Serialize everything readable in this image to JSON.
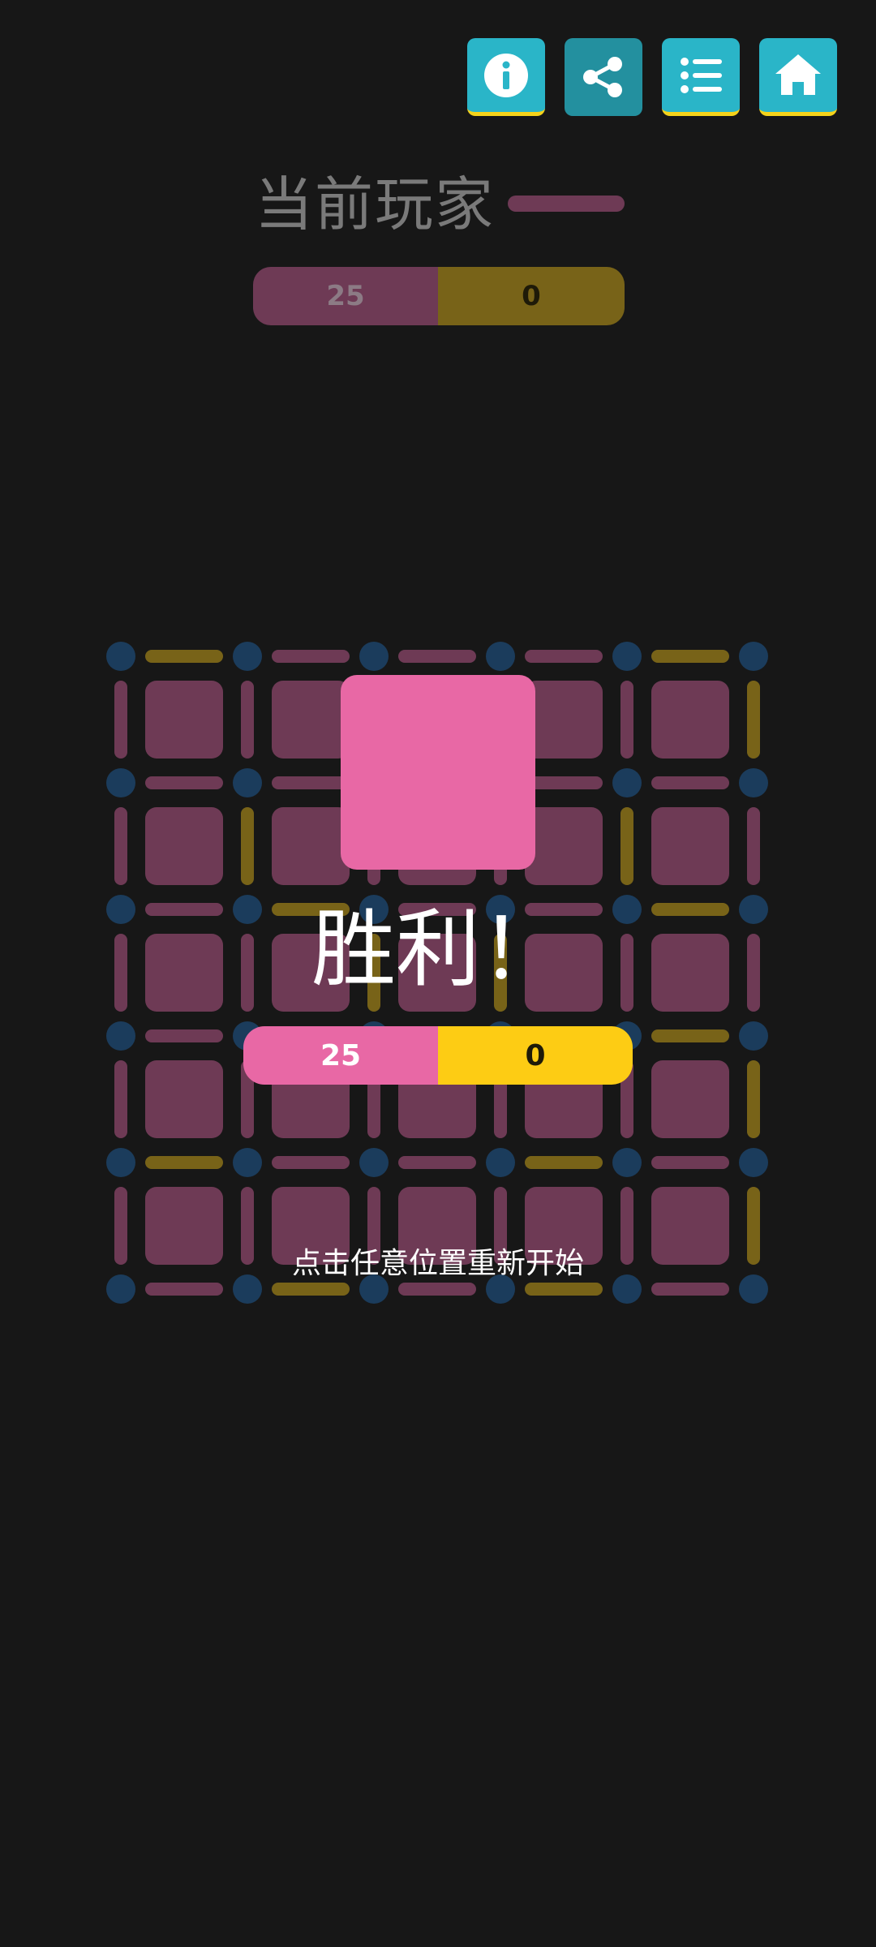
{
  "toolbar": {
    "buttons": [
      {
        "name": "info-button",
        "icon": "info-icon"
      },
      {
        "name": "share-button",
        "icon": "share-icon"
      },
      {
        "name": "list-button",
        "icon": "list-icon"
      },
      {
        "name": "home-button",
        "icon": "home-icon"
      }
    ]
  },
  "status": {
    "current_player_label": "当前玩家"
  },
  "score": {
    "player1": "25",
    "player2": "0"
  },
  "result": {
    "title": "胜利！",
    "player1": "25",
    "player2": "0",
    "restart_hint": "点击任意位置重新开始"
  },
  "colors": {
    "background": "#171717",
    "dot": "#1b3c5c",
    "player1_dim": "#6e3a55",
    "player2_dim": "#786318",
    "player1": "#e868a5",
    "player2": "#fdcc14",
    "toolbar": "#2ab5c8",
    "toolbar_accent": "#f5d21a"
  },
  "board": {
    "rows": 5,
    "cols": 5,
    "horizontal_lines": [
      [
        "p2",
        "p1",
        "p1",
        "p1",
        "p2"
      ],
      [
        "p1",
        "p1",
        "p1",
        "p1",
        "p1"
      ],
      [
        "p1",
        "p2",
        "p1",
        "p1",
        "p2"
      ],
      [
        "p1",
        "p1",
        "p1",
        "p1",
        "p2"
      ],
      [
        "p2",
        "p1",
        "p1",
        "p2",
        "p1"
      ],
      [
        "p1",
        "p2",
        "p1",
        "p2",
        "p1"
      ]
    ],
    "vertical_lines": [
      [
        "p1",
        "p1",
        "p1",
        "p1",
        "p1",
        "p2"
      ],
      [
        "p1",
        "p2",
        "p1",
        "p1",
        "p2",
        "p1"
      ],
      [
        "p1",
        "p1",
        "p2",
        "p2",
        "p1",
        "p1"
      ],
      [
        "p1",
        "p1",
        "p1",
        "p1",
        "p1",
        "p2"
      ],
      [
        "p1",
        "p1",
        "p1",
        "p1",
        "p1",
        "p2"
      ]
    ],
    "box_owners": [
      [
        "p1",
        "p1",
        "p1",
        "p1",
        "p1"
      ],
      [
        "p1",
        "p1",
        "p1",
        "p1",
        "p1"
      ],
      [
        "p1",
        "p1",
        "p1",
        "p1",
        "p1"
      ],
      [
        "p1",
        "p1",
        "p1",
        "p1",
        "p1"
      ],
      [
        "p1",
        "p1",
        "p1",
        "p1",
        "p1"
      ]
    ]
  }
}
